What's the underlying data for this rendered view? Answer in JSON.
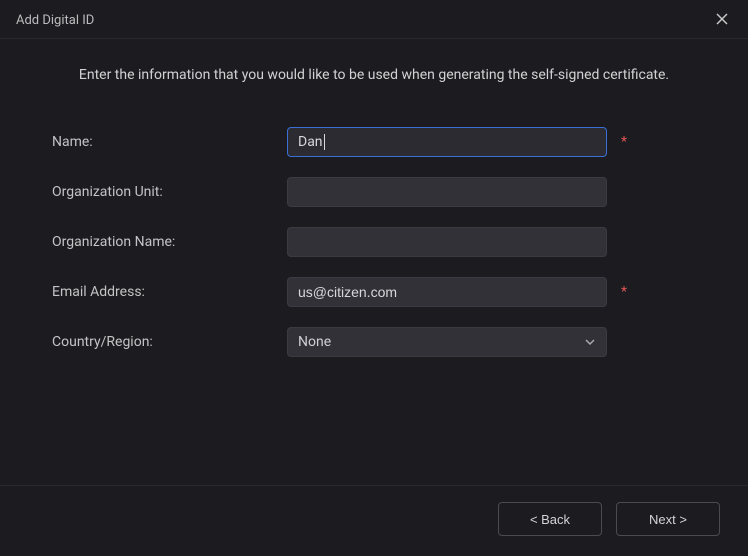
{
  "dialog": {
    "title": "Add Digital ID",
    "description": "Enter the information that you would like to be used when generating the self-signed certificate."
  },
  "fields": {
    "name": {
      "label": "Name:",
      "value": "Dan",
      "required": true
    },
    "orgUnit": {
      "label": "Organization Unit:",
      "value": "",
      "required": false
    },
    "orgName": {
      "label": "Organization Name:",
      "value": "",
      "required": false
    },
    "email": {
      "label": "Email Address:",
      "value": "us@citizen.com",
      "required": true
    },
    "country": {
      "label": "Country/Region:",
      "selected": "None",
      "required": false
    }
  },
  "buttons": {
    "back": "< Back",
    "next": "Next >"
  },
  "requiredMark": "*"
}
